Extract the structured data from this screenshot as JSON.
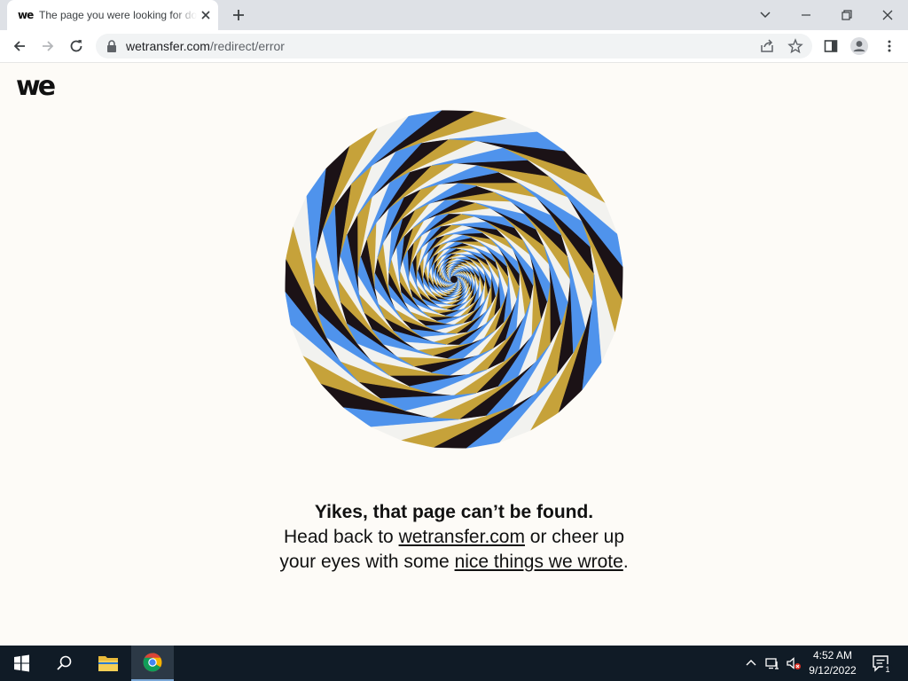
{
  "browser": {
    "tab_title": "The page you were looking for doesn't exist",
    "tab_favicon_text": "we",
    "url_host": "wetransfer.com",
    "url_path": "/redirect/error"
  },
  "page": {
    "logo_text": "we",
    "headline": "Yikes, that page can’t be found.",
    "body_prefix": "Head back to ",
    "link_home": "wetransfer.com",
    "body_middle": " or cheer up your eyes with some ",
    "link_nice": "nice things we wrote",
    "body_suffix": ".",
    "spiral_colors": [
      "#1b1216",
      "#c6a23a",
      "#f2f2ef",
      "#4f93ec"
    ]
  },
  "taskbar": {
    "time": "4:52 AM",
    "date": "9/12/2022",
    "notification_count": "1"
  }
}
